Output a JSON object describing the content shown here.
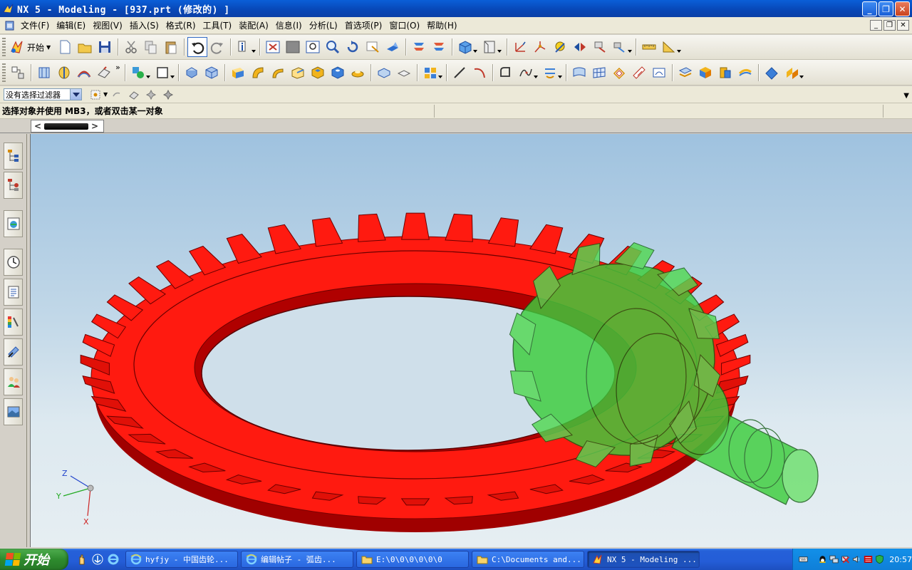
{
  "window": {
    "title": "NX 5 - Modeling - [937.prt  (修改的) ]",
    "buttons": [
      "_",
      "❐",
      "✕"
    ]
  },
  "menubar": {
    "items": [
      "文件(F)",
      "编辑(E)",
      "视图(V)",
      "插入(S)",
      "格式(R)",
      "工具(T)",
      "装配(A)",
      "信息(I)",
      "分析(L)",
      "首选项(P)",
      "窗口(O)",
      "帮助(H)"
    ],
    "mdi_buttons": [
      "_",
      "❐",
      "✕"
    ]
  },
  "toolbar1": {
    "start_label": "开始",
    "icons": [
      "new-file-icon",
      "open-folder-icon",
      "save-icon",
      "cut-icon",
      "copy-icon",
      "paste-icon",
      "undo-icon",
      "redo-icon",
      "command-finder-icon",
      "fit-view-icon",
      "shaded-view-icon",
      "zoom-window-icon",
      "zoom-icon",
      "rotate-icon",
      "pan-icon",
      "perspective-icon",
      "assembly-nav-icon",
      "part-nav-icon",
      "cube-render-icon",
      "section-view-icon",
      "wcs-icon",
      "snap-point-icon",
      "constraint-icon",
      "render-icon",
      "sketch-icon",
      "measure-icon",
      "ruler-icon"
    ]
  },
  "toolbar2": {
    "icons": [
      "layer-icon",
      "extrude-icon",
      "revolve-icon",
      "sweep-icon",
      "blend-icon",
      "datum-icon",
      "sketch-rect-icon",
      "cylinder-icon",
      "block-icon",
      "cone-icon",
      "sphere-icon",
      "edge-blend-icon",
      "chamfer-icon",
      "shell-icon",
      "hole-icon",
      "boss-icon",
      "pad-icon",
      "pocket-icon",
      "slot-icon",
      "groove-icon",
      "line-icon",
      "arc-icon",
      "curve-icon",
      "spline-icon",
      "offset-icon",
      "surface-icon",
      "mesh-icon",
      "thicken-icon",
      "trim-icon",
      "sew-icon",
      "analysis-icon",
      "render-blue-icon",
      "render-gold-icon",
      "shade-icon",
      "material-icon"
    ]
  },
  "selection_bar": {
    "filter_value": "没有选择过滤器"
  },
  "status": {
    "prompt": "选择对象并使用 MB3，或者双击某一对象"
  },
  "resource_bar": {
    "icons": [
      "assembly-navigator-icon",
      "part-navigator-icon",
      "web-browser-icon",
      "history-icon",
      "reuse-library-icon",
      "color-palette-icon",
      "process-studio-icon",
      "roles-icon",
      "system-scenes-icon"
    ]
  },
  "viewport": {
    "gear_color": "#ff1a10",
    "pinion_color": "#3ccd3c",
    "triad": {
      "z": "Z",
      "y": "Y",
      "x": "X"
    }
  },
  "taskbar": {
    "start_label": "开始",
    "items": [
      {
        "label": "hyfjy - 中国齿轮...",
        "icon": "ie-icon"
      },
      {
        "label": "编辑帖子 - 弧齿...",
        "icon": "ie-icon"
      },
      {
        "label": "E:\\0\\0\\0\\0\\0\\0",
        "icon": "folder-icon"
      },
      {
        "label": "C:\\Documents and...",
        "icon": "folder-icon"
      },
      {
        "label": "NX 5 - Modeling ...",
        "icon": "nx-icon"
      }
    ],
    "clock": "20:57"
  }
}
